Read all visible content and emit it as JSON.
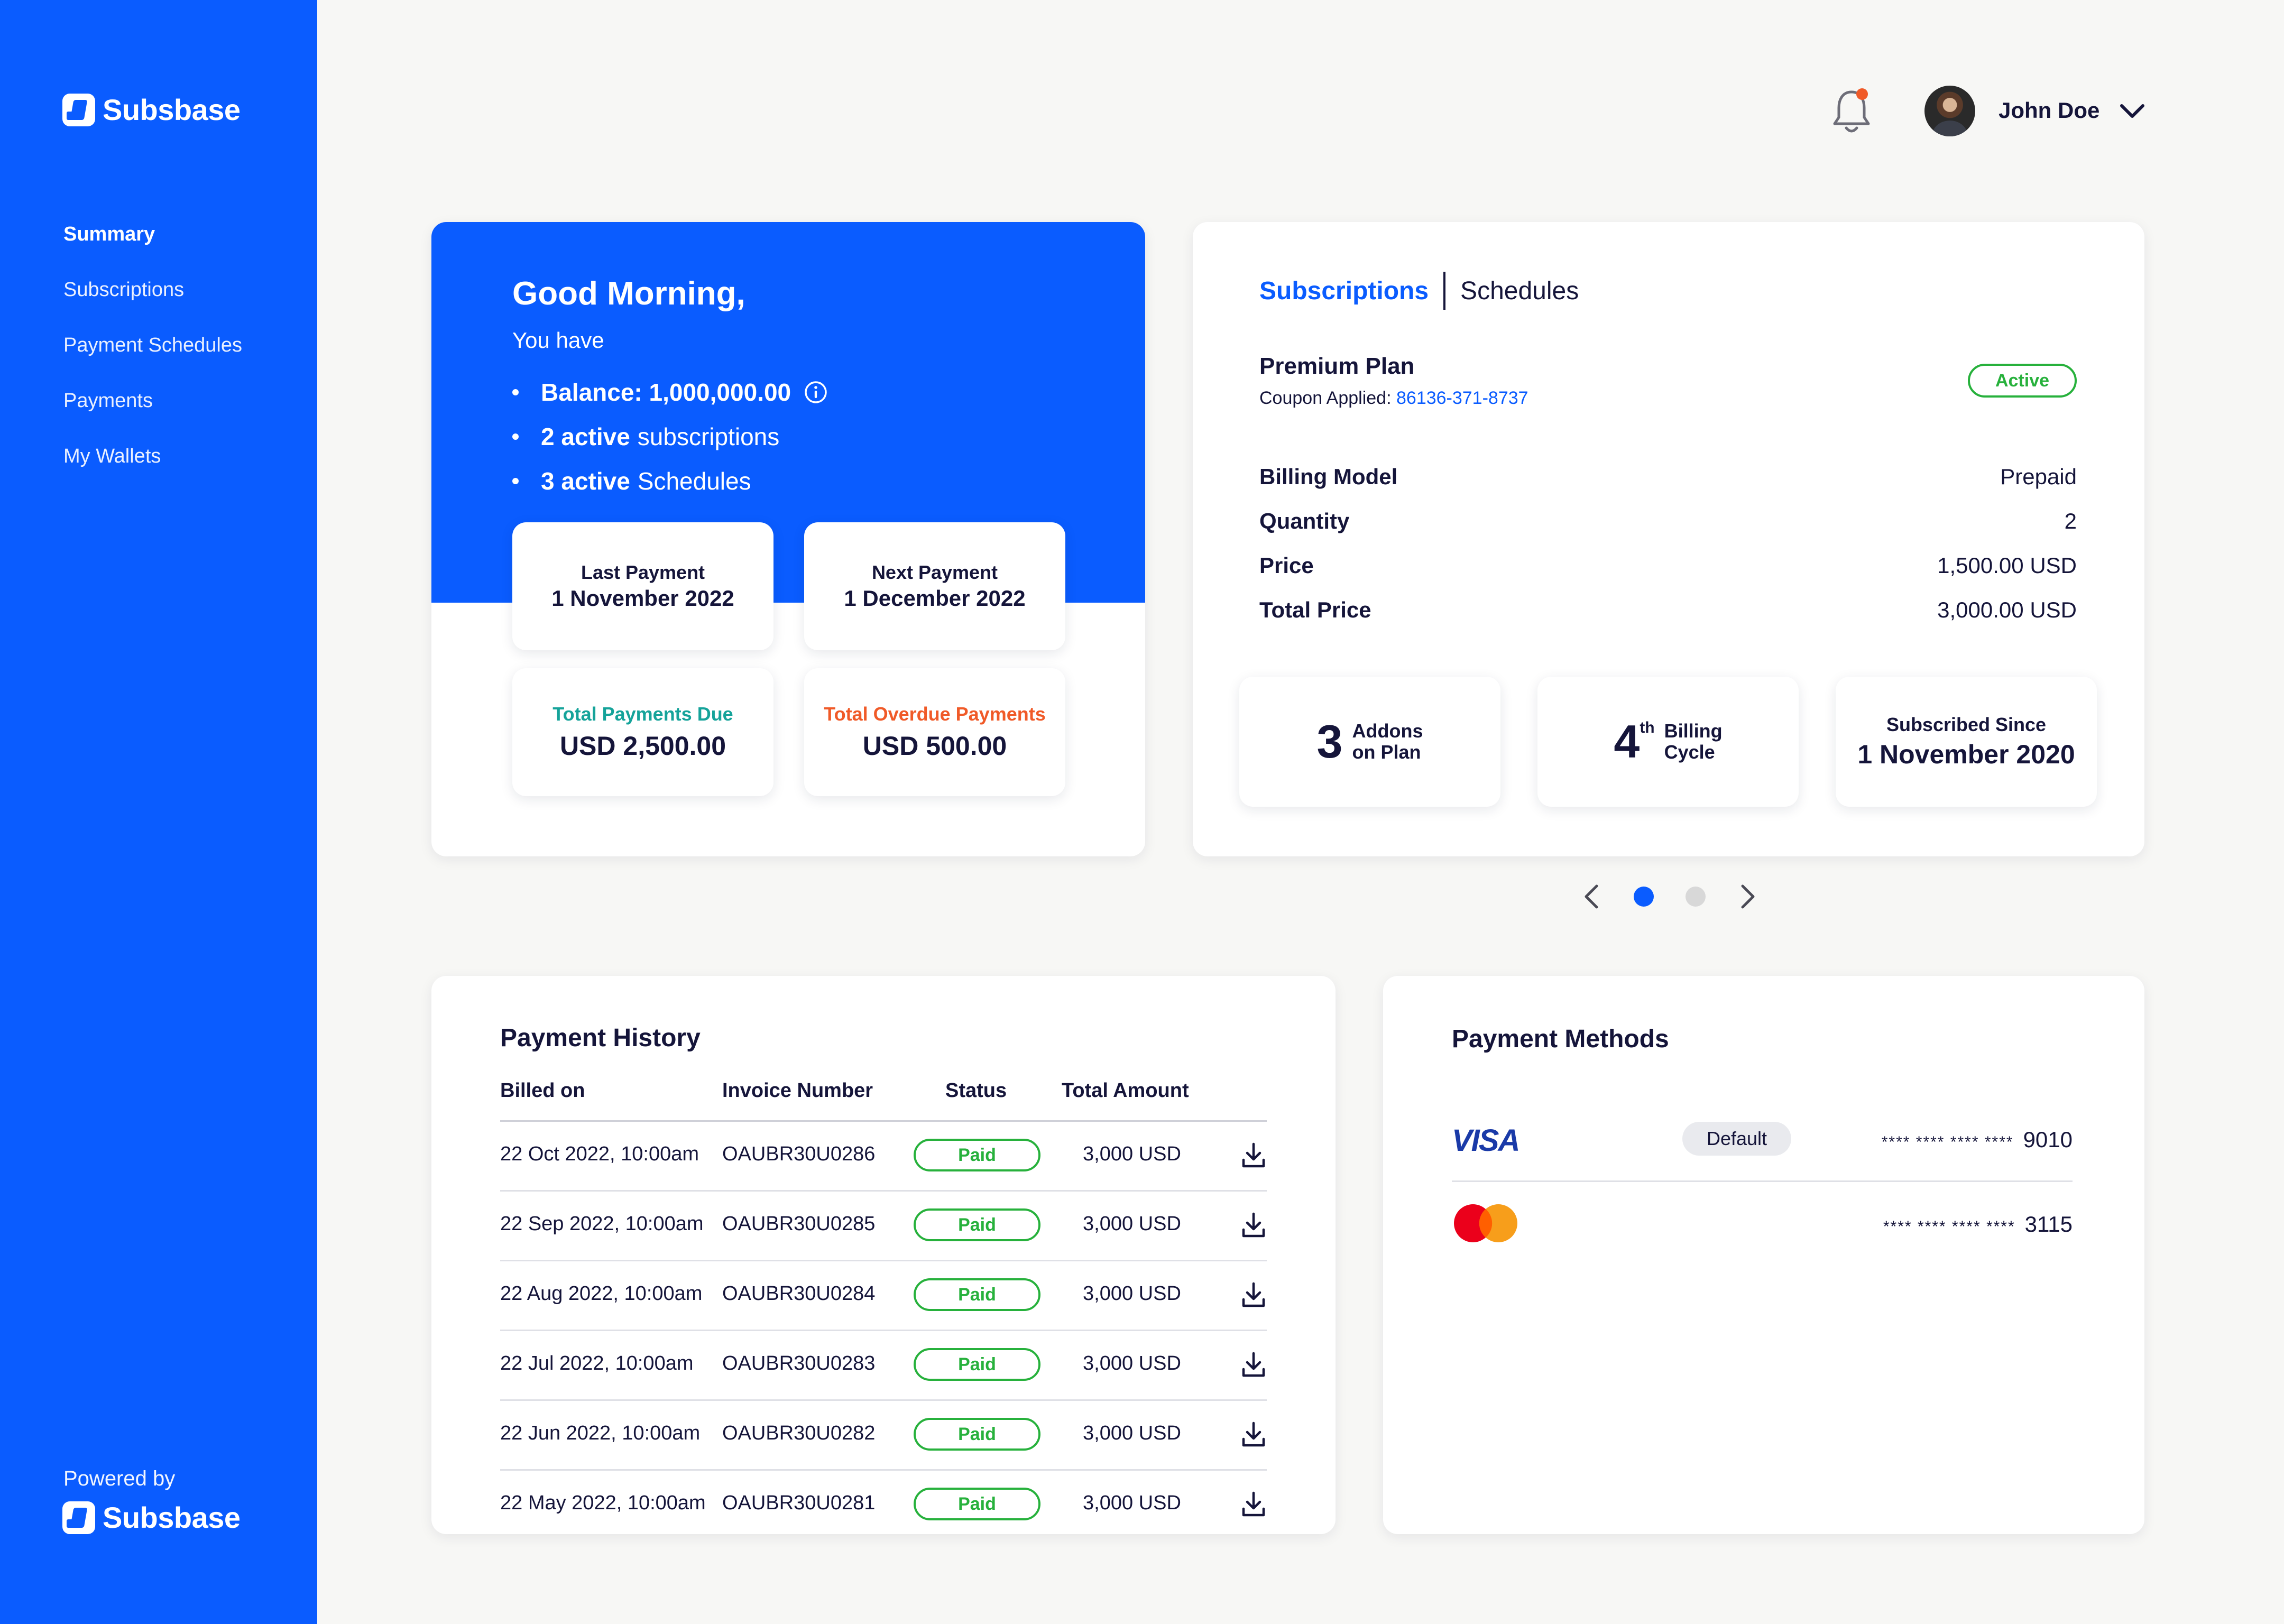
{
  "brand": {
    "name": "Subsbase",
    "powered_by": "Powered by"
  },
  "sidebar": {
    "items": [
      {
        "label": "Summary",
        "active": true
      },
      {
        "label": "Subscriptions"
      },
      {
        "label": "Payment Schedules"
      },
      {
        "label": "Payments"
      },
      {
        "label": "My Wallets"
      }
    ]
  },
  "header": {
    "user_name": "John Doe",
    "notification_dot_color": "#f05a28"
  },
  "greeting": {
    "title": "Good Morning,",
    "subtitle": "You have",
    "balance_label": "Balance: 1,000,000.00",
    "subs_bold": "2 active",
    "subs_rest": "subscriptions",
    "sched_bold": "3 active",
    "sched_rest": "Schedules",
    "last_payment": {
      "label": "Last Payment",
      "value": "1 November 2022"
    },
    "next_payment": {
      "label": "Next Payment",
      "value": "1 December 2022"
    },
    "total_due": {
      "label": "Total Payments Due",
      "value": "USD 2,500.00"
    },
    "total_overdue": {
      "label": "Total Overdue Payments",
      "value": "USD 500.00"
    }
  },
  "subscription": {
    "tabs": [
      {
        "label": "Subscriptions",
        "active": true
      },
      {
        "label": "Schedules"
      }
    ],
    "plan_name": "Premium Plan",
    "coupon_label": "Coupon Applied:",
    "coupon_code": "86136-371-8737",
    "status": "Active",
    "details": [
      {
        "key": "Billing Model",
        "value": "Prepaid"
      },
      {
        "key": "Quantity",
        "value": "2"
      },
      {
        "key": "Price",
        "value": "1,500.00 USD"
      },
      {
        "key": "Total Price",
        "value": "3,000.00 USD"
      }
    ],
    "addons": {
      "num": "3",
      "line1": "Addons",
      "line2": "on Plan"
    },
    "billing_cycle": {
      "num": "4",
      "sup": "th",
      "line1": "Billing",
      "line2": "Cycle"
    },
    "subscribed_since": {
      "label": "Subscribed Since",
      "value": "1 November 2020"
    },
    "pager": {
      "pages": 2,
      "current": 1
    }
  },
  "payment_history": {
    "title": "Payment History",
    "columns": [
      "Billed on",
      "Invoice Number",
      "Status",
      "Total Amount"
    ],
    "rows": [
      {
        "billed": "22 Oct 2022, 10:00am",
        "invoice": "OAUBR30U0286",
        "status": "Paid",
        "amount": "3,000 USD"
      },
      {
        "billed": "22 Sep 2022, 10:00am",
        "invoice": "OAUBR30U0285",
        "status": "Paid",
        "amount": "3,000 USD"
      },
      {
        "billed": "22 Aug 2022, 10:00am",
        "invoice": "OAUBR30U0284",
        "status": "Paid",
        "amount": "3,000 USD"
      },
      {
        "billed": "22 Jul 2022, 10:00am",
        "invoice": "OAUBR30U0283",
        "status": "Paid",
        "amount": "3,000 USD"
      },
      {
        "billed": "22 Jun 2022, 10:00am",
        "invoice": "OAUBR30U0282",
        "status": "Paid",
        "amount": "3,000 USD"
      },
      {
        "billed": "22 May 2022, 10:00am",
        "invoice": "OAUBR30U0281",
        "status": "Paid",
        "amount": "3,000 USD"
      }
    ]
  },
  "payment_methods": {
    "title": "Payment Methods",
    "cards": [
      {
        "brand": "VISA",
        "default_label": "Default",
        "stars": "**** **** **** ****",
        "last4": "9010"
      },
      {
        "brand": "mastercard",
        "stars": "**** **** **** ****",
        "last4": "3115"
      }
    ]
  },
  "colors": {
    "primary": "#0a5cff",
    "success": "#27b13c",
    "teal": "#15a39a",
    "danger": "#f05a28",
    "ink": "#15153a"
  }
}
